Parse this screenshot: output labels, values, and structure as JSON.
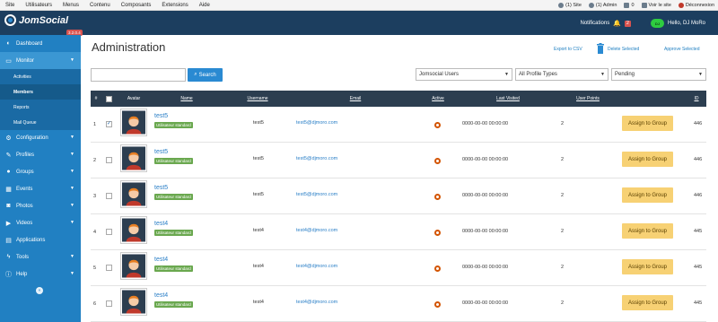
{
  "topbar": {
    "menu": [
      "Site",
      "Utilisateurs",
      "Menus",
      "Contenu",
      "Composants",
      "Extensions",
      "Aide"
    ],
    "status": [
      {
        "icon": "site-visitors-icon",
        "label": "(1) Site"
      },
      {
        "icon": "admin-users-icon",
        "label": "(1) Admin"
      },
      {
        "icon": "mail-icon",
        "label": "0"
      },
      {
        "icon": "view-site-icon",
        "label": "Voir le site"
      },
      {
        "icon": "logout-icon",
        "label": "Déconnexion"
      }
    ]
  },
  "header": {
    "logo_text": "JomSocial",
    "version": "3.2.0.4",
    "notifications_label": "Notifications",
    "notifications_count": "2",
    "greeting": "Hello, DJ MoRo",
    "avatar_text": "DJ"
  },
  "sidebar": {
    "items": [
      {
        "label": "Dashboard",
        "icon": "dashboard-icon",
        "chevron": false
      },
      {
        "label": "Monitor",
        "icon": "monitor-icon",
        "chevron": true,
        "active": true
      },
      {
        "label": "Configuration",
        "icon": "gears-icon",
        "chevron": true
      },
      {
        "label": "Profiles",
        "icon": "profiles-icon",
        "chevron": true
      },
      {
        "label": "Groups",
        "icon": "groups-icon",
        "chevron": true
      },
      {
        "label": "Events",
        "icon": "calendar-icon",
        "chevron": true
      },
      {
        "label": "Photos",
        "icon": "camera-icon",
        "chevron": true
      },
      {
        "label": "Videos",
        "icon": "video-icon",
        "chevron": true
      },
      {
        "label": "Applications",
        "icon": "applications-icon",
        "chevron": false
      },
      {
        "label": "Tools",
        "icon": "wrench-icon",
        "chevron": true
      },
      {
        "label": "Help",
        "icon": "help-icon",
        "chevron": true
      }
    ],
    "monitor_sub": [
      "Activities",
      "Members",
      "Reports",
      "Mail Queue"
    ],
    "current_sub": "Members",
    "collapse_glyph": "«"
  },
  "main": {
    "title": "Administration",
    "export_label": "Export to CSV",
    "delete_label": "Delete Selected",
    "approve_label": "Approve Selected",
    "search_placeholder": "",
    "search_button": "Search",
    "filters": [
      "Jomsocial Users",
      "All Profile Types",
      "Pending"
    ]
  },
  "table": {
    "headers": [
      "#",
      "",
      "Avatar",
      "Name",
      "Username",
      "Email",
      "Active",
      "Last Visited",
      "User Points",
      "",
      "ID"
    ],
    "rows": [
      {
        "num": "1",
        "checked": true,
        "name": "test5",
        "group": "Utilisateur standard",
        "username": "test5",
        "email": "test5@djmoro.com",
        "last_visited": "0000-00-00 00:00:00",
        "points": "2",
        "action": "Assign to Group",
        "id": "446"
      },
      {
        "num": "2",
        "checked": false,
        "name": "test5",
        "group": "Utilisateur standard",
        "username": "test5",
        "email": "test5@djmoro.com",
        "last_visited": "0000-00-00 00:00:00",
        "points": "2",
        "action": "Assign to Group",
        "id": "446"
      },
      {
        "num": "3",
        "checked": false,
        "name": "test5",
        "group": "Utilisateur standard",
        "username": "test5",
        "email": "test5@djmoro.com",
        "last_visited": "0000-00-00 00:00:00",
        "points": "2",
        "action": "Assign to Group",
        "id": "446"
      },
      {
        "num": "4",
        "checked": false,
        "name": "test4",
        "group": "Utilisateur standard",
        "username": "test4",
        "email": "test4@djmoro.com",
        "last_visited": "0000-00-00 00:00:00",
        "points": "2",
        "action": "Assign to Group",
        "id": "445"
      },
      {
        "num": "5",
        "checked": false,
        "name": "test4",
        "group": "Utilisateur standard",
        "username": "test4",
        "email": "test4@djmoro.com",
        "last_visited": "0000-00-00 00:00:00",
        "points": "2",
        "action": "Assign to Group",
        "id": "445"
      },
      {
        "num": "6",
        "checked": false,
        "name": "test4",
        "group": "Utilisateur standard",
        "username": "test4",
        "email": "test4@djmoro.com",
        "last_visited": "0000-00-00 00:00:00",
        "points": "2",
        "action": "Assign to Group",
        "id": "445"
      }
    ]
  },
  "colors": {
    "header_bg": "#1c3e5f",
    "sidebar_bg": "#2180c2",
    "table_head_bg": "#2c3e50",
    "assign_button_bg": "#f7d174",
    "group_badge_bg": "#6aa84f",
    "link": "#2a7fc7"
  }
}
